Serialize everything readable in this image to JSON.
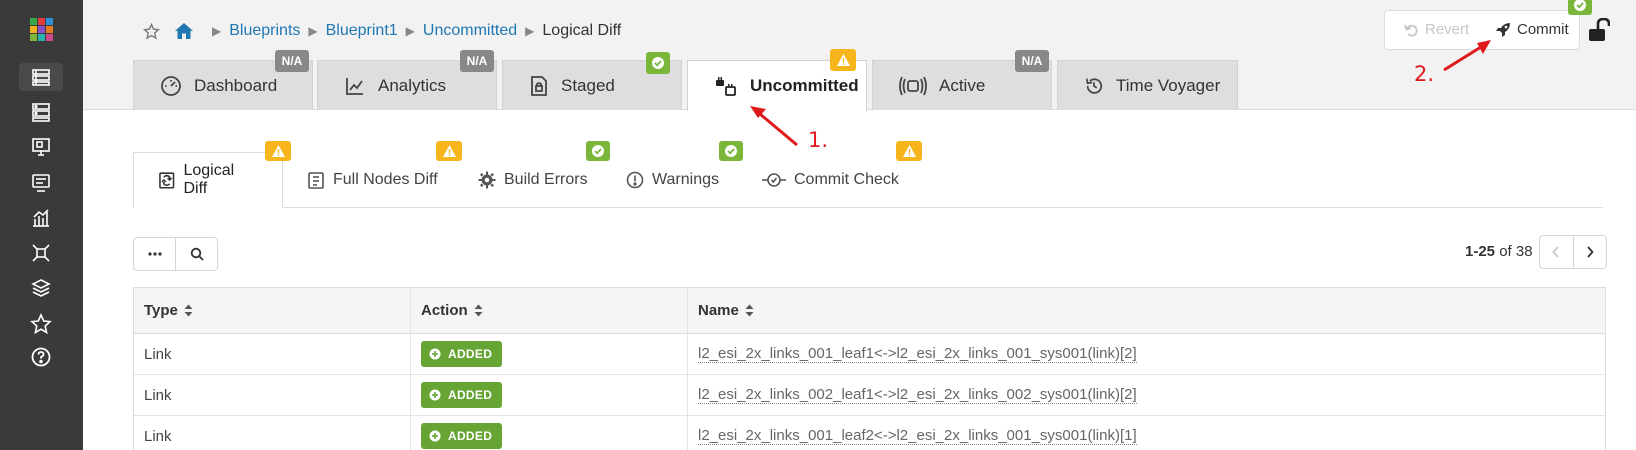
{
  "sidebar": {
    "items": [
      {
        "icon": "blueprints-icon",
        "active": true
      },
      {
        "icon": "devices-icon"
      },
      {
        "icon": "design-icon"
      },
      {
        "icon": "resources-icon"
      },
      {
        "icon": "analytics-icon"
      },
      {
        "icon": "external-systems-icon"
      },
      {
        "icon": "platform-icon"
      },
      {
        "icon": "favorites-icon"
      },
      {
        "icon": "help-icon"
      }
    ]
  },
  "breadcrumb": {
    "items": [
      "Blueprints",
      "Blueprint1",
      "Uncommitted"
    ],
    "current": "Logical Diff"
  },
  "main_tabs": [
    {
      "label": "Dashboard",
      "badge": "N/A",
      "badge_type": "na"
    },
    {
      "label": "Analytics",
      "badge": "N/A",
      "badge_type": "na"
    },
    {
      "label": "Staged",
      "badge": "",
      "badge_type": "ok"
    },
    {
      "label": "Uncommitted",
      "badge": "",
      "badge_type": "warn",
      "active": true
    },
    {
      "label": "Active",
      "badge": "N/A",
      "badge_type": "na"
    },
    {
      "label": "Time Voyager"
    }
  ],
  "actions": {
    "revert_label": "Revert",
    "commit_label": "Commit",
    "commit_badge_type": "ok"
  },
  "sub_tabs": [
    {
      "label": "Logical Diff",
      "badge_type": "warn",
      "active": true
    },
    {
      "label": "Full Nodes Diff",
      "badge_type": "warn"
    },
    {
      "label": "Build Errors",
      "badge_type": "ok"
    },
    {
      "label": "Warnings",
      "badge_type": "ok"
    },
    {
      "label": "Commit Check",
      "badge_type": "warn"
    }
  ],
  "pagination": {
    "range": "1-25",
    "of_label": "of",
    "total": "38"
  },
  "table": {
    "columns": [
      "Type",
      "Action",
      "Name"
    ],
    "rows": [
      {
        "type": "Link",
        "action": "ADDED",
        "name": "l2_esi_2x_links_001_leaf1<->l2_esi_2x_links_001_sys001(link)[2]"
      },
      {
        "type": "Link",
        "action": "ADDED",
        "name": "l2_esi_2x_links_002_leaf1<->l2_esi_2x_links_002_sys001(link)[2]"
      },
      {
        "type": "Link",
        "action": "ADDED",
        "name": "l2_esi_2x_links_001_leaf2<->l2_esi_2x_links_001_sys001(link)[1]"
      }
    ]
  },
  "annotations": [
    "1.",
    "2."
  ],
  "colors": {
    "sidebar": "#3a3a3a",
    "link": "#1f78b4",
    "ok": "#7ab63a",
    "warn": "#f5b51b",
    "na": "#888888",
    "added": "#66a534",
    "annotation": "#e0191c"
  }
}
